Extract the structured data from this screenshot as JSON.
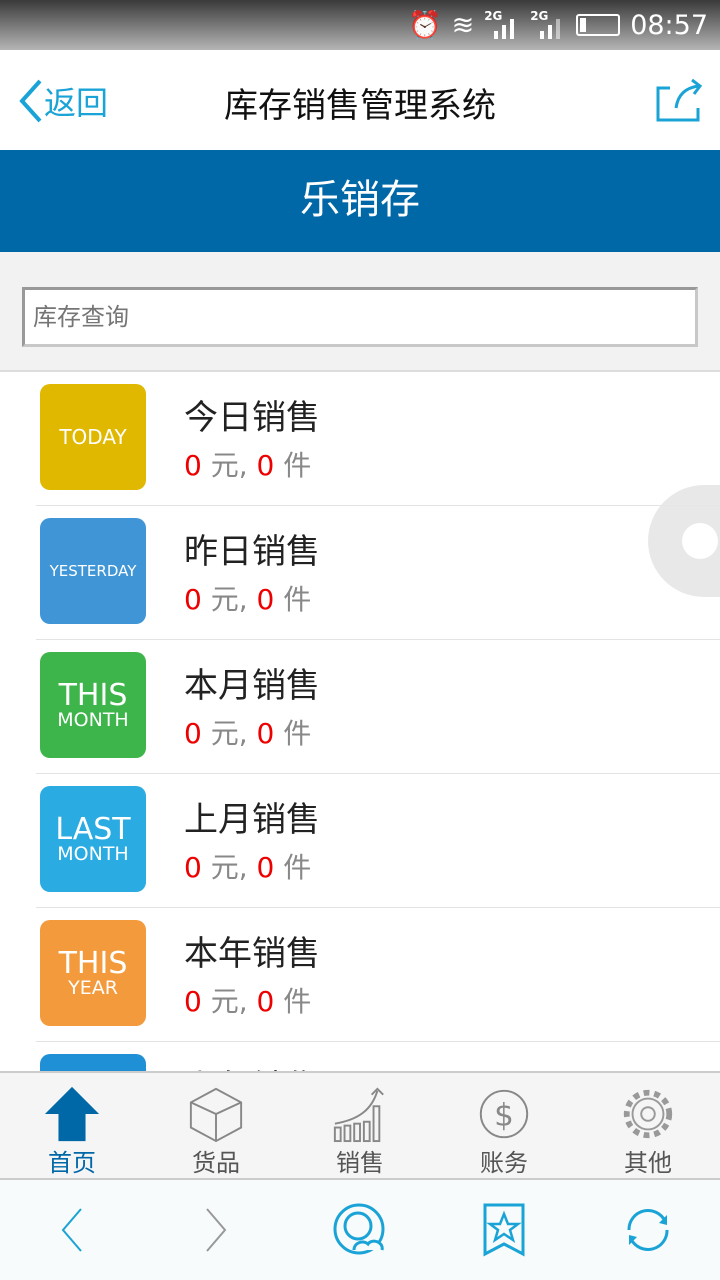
{
  "status_bar": {
    "time": "08:57",
    "network1": "2G",
    "network2": "2G"
  },
  "header": {
    "back_label": "返回",
    "title": "库存销售管理系统"
  },
  "banner": {
    "title": "乐销存"
  },
  "search": {
    "placeholder": "库存查询",
    "value": ""
  },
  "colors": {
    "accent": "#0168a8",
    "link": "#1aa3d6",
    "value_red": "#e00000"
  },
  "list": [
    {
      "badge_a": "TODAY",
      "badge_b": "",
      "color": "#e0b800",
      "title": "今日销售",
      "amount": "0",
      "amount_unit": "元,",
      "count": "0",
      "count_unit": "件"
    },
    {
      "badge_a": "YESTERDAY",
      "badge_b": "",
      "color": "#3f95d6",
      "title": "昨日销售",
      "amount": "0",
      "amount_unit": "元,",
      "count": "0",
      "count_unit": "件"
    },
    {
      "badge_a": "THIS",
      "badge_b": "MONTH",
      "color": "#3db54a",
      "title": "本月销售",
      "amount": "0",
      "amount_unit": "元,",
      "count": "0",
      "count_unit": "件"
    },
    {
      "badge_a": "LAST",
      "badge_b": "MONTH",
      "color": "#2aabe2",
      "title": "上月销售",
      "amount": "0",
      "amount_unit": "元,",
      "count": "0",
      "count_unit": "件"
    },
    {
      "badge_a": "THIS",
      "badge_b": "YEAR",
      "color": "#f39a3c",
      "title": "本年销售",
      "amount": "0",
      "amount_unit": "元,",
      "count": "0",
      "count_unit": "件"
    },
    {
      "badge_a": "",
      "badge_b": "",
      "color": "#1f8fd6",
      "title": "上年销售",
      "amount": "",
      "amount_unit": "",
      "count": "",
      "count_unit": ""
    }
  ],
  "tabs": [
    {
      "label": "首页",
      "icon": "home-icon",
      "active": true
    },
    {
      "label": "货品",
      "icon": "box-icon"
    },
    {
      "label": "销售",
      "icon": "chart-icon"
    },
    {
      "label": "账务",
      "icon": "dollar-icon"
    },
    {
      "label": "其他",
      "icon": "gear-icon"
    }
  ]
}
